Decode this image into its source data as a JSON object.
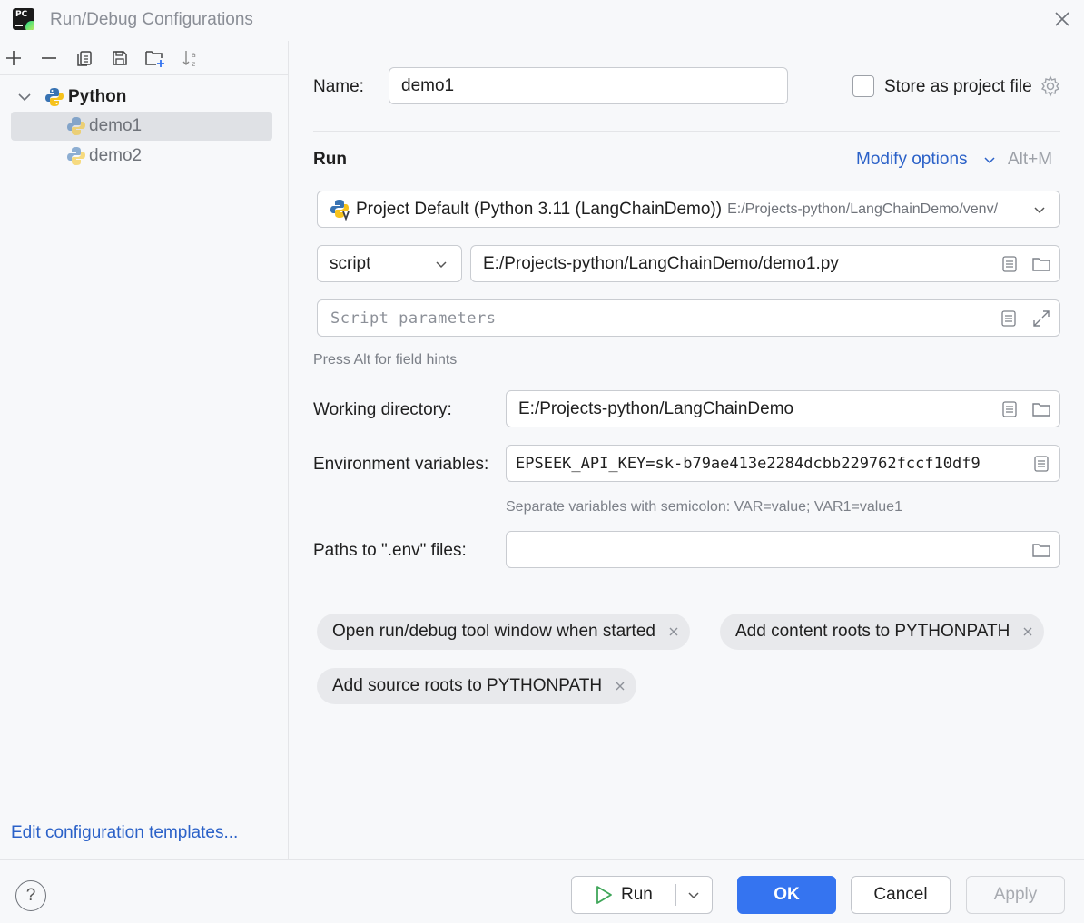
{
  "window": {
    "title": "Run/Debug Configurations"
  },
  "sidebar": {
    "tree": {
      "group_label": "Python",
      "items": [
        {
          "label": "demo1",
          "selected": true
        },
        {
          "label": "demo2",
          "selected": false
        }
      ]
    },
    "edit_templates_link": "Edit configuration templates..."
  },
  "form": {
    "name_label": "Name:",
    "name_value": "demo1",
    "store_project_file_label": "Store as project file",
    "store_project_file_checked": false,
    "run_section_title": "Run",
    "modify_options_label": "Modify options",
    "modify_options_shortcut": "Alt+M",
    "interpreter": {
      "name": "Project Default (Python 3.11 (LangChainDemo))",
      "path": "E:/Projects-python/LangChainDemo/venv/"
    },
    "script_type": "script",
    "script_path": "E:/Projects-python/LangChainDemo/demo1.py",
    "script_parameters_placeholder": "Script parameters",
    "field_hints_text": "Press Alt for field hints",
    "working_dir_label": "Working directory:",
    "working_dir_value": "E:/Projects-python/LangChainDemo",
    "env_vars_label": "Environment variables:",
    "env_vars_value": "EPSEEK_API_KEY=sk-b79ae413e2284dcbb229762fccf10df9",
    "env_vars_hint": "Separate variables with semicolon: VAR=value; VAR1=value1",
    "env_files_label": "Paths to \".env\" files:",
    "env_files_value": "",
    "chips": [
      "Open run/debug tool window when started",
      "Add content roots to PYTHONPATH",
      "Add source roots to PYTHONPATH"
    ]
  },
  "footer": {
    "help_label": "?",
    "run_label": "Run",
    "ok_label": "OK",
    "cancel_label": "Cancel",
    "apply_label": "Apply"
  },
  "colors": {
    "accent": "#3574f0",
    "link": "#2b61c8",
    "selection": "#dfe1e5",
    "background": "#f7f8fa"
  }
}
